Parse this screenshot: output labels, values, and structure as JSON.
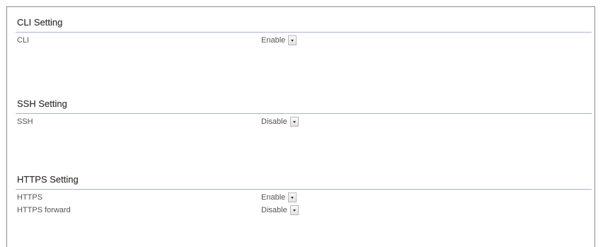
{
  "sections": [
    {
      "title": "CLI Setting",
      "rows": [
        {
          "label": "CLI",
          "value": "Enable"
        }
      ]
    },
    {
      "title": "SSH Setting",
      "rows": [
        {
          "label": "SSH",
          "value": "Disable"
        }
      ]
    },
    {
      "title": "HTTPS Setting",
      "rows": [
        {
          "label": "HTTPS",
          "value": "Enable"
        },
        {
          "label": "HTTPS forward",
          "value": "Disable"
        }
      ]
    }
  ],
  "icons": {
    "dropdown": "chevron-down-icon"
  }
}
